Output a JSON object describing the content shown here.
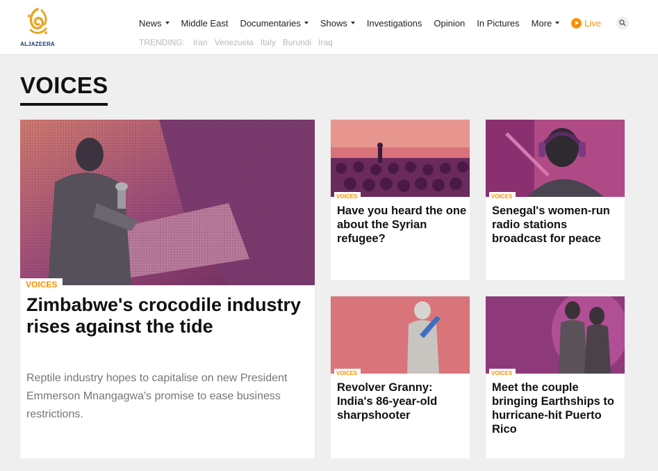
{
  "site": {
    "logo_text": "ALJAZEERA"
  },
  "nav": {
    "items": [
      {
        "label": "News",
        "dropdown": true
      },
      {
        "label": "Middle East",
        "dropdown": false
      },
      {
        "label": "Documentaries",
        "dropdown": true
      },
      {
        "label": "Shows",
        "dropdown": true
      },
      {
        "label": "Investigations",
        "dropdown": false
      },
      {
        "label": "Opinion",
        "dropdown": false
      },
      {
        "label": "In Pictures",
        "dropdown": false
      },
      {
        "label": "More",
        "dropdown": true
      }
    ],
    "live_label": "Live",
    "search_icon": "search-icon"
  },
  "trending": {
    "label": "TRENDING:",
    "items": [
      "Iran",
      "Venezuela",
      "Italy",
      "Burundi",
      "Iraq"
    ]
  },
  "section": {
    "title": "VOICES"
  },
  "featured": {
    "tag": "VOICES",
    "title": "Zimbabwe's crocodile industry rises against the tide",
    "description": "Reptile industry hopes to capitalise on new President Emmerson Mnangagwa's promise to ease business restrictions."
  },
  "cards": [
    {
      "tag": "VOICES",
      "title": "Have you heard the one about the Syrian refugee?"
    },
    {
      "tag": "VOICES",
      "title": "Senegal's women-run radio stations broadcast for peace"
    },
    {
      "tag": "VOICES",
      "title": "Revolver Granny: India's 86-year-old sharpshooter"
    },
    {
      "tag": "VOICES",
      "title": "Meet the couple bringing Earthships to hurricane-hit Puerto Rico"
    }
  ],
  "colors": {
    "accent": "#fa9000",
    "duotone_dark": "#5a2450",
    "duotone_light": "#e07a5a"
  }
}
